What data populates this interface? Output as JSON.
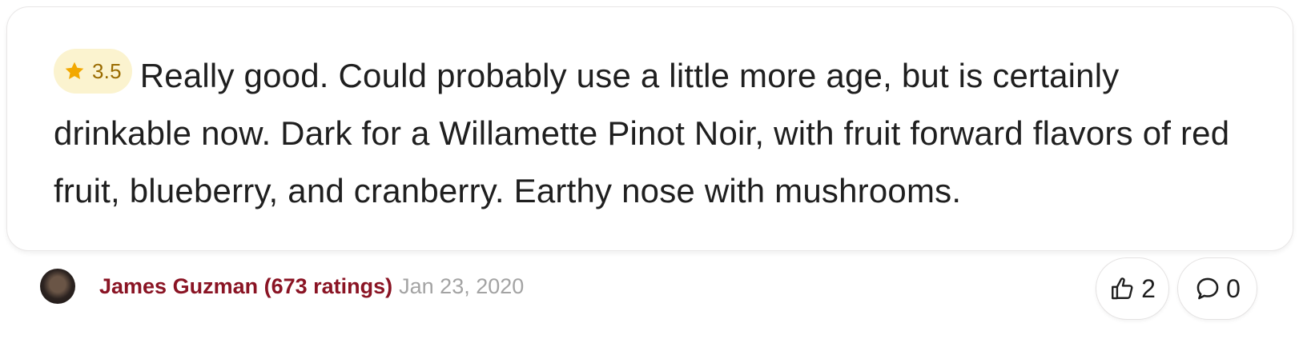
{
  "review": {
    "rating": "3.5",
    "text": "Really good. Could probably use a little more age, but is certainly drinkable now. Dark for a Willamette Pinot Noir, with fruit forward flavors of red fruit, blueberry, and cranberry. Earthy nose with mushrooms.",
    "rating_icon": "star-icon",
    "rating_color": "#f2a800"
  },
  "author": {
    "name_and_count": "James Guzman (673 ratings)",
    "date": "Jan 23, 2020",
    "name_color": "#8a1424"
  },
  "actions": {
    "likes_count": "2",
    "likes_icon": "thumbs-up-icon",
    "comments_count": "0",
    "comments_icon": "comment-bubble-icon"
  }
}
